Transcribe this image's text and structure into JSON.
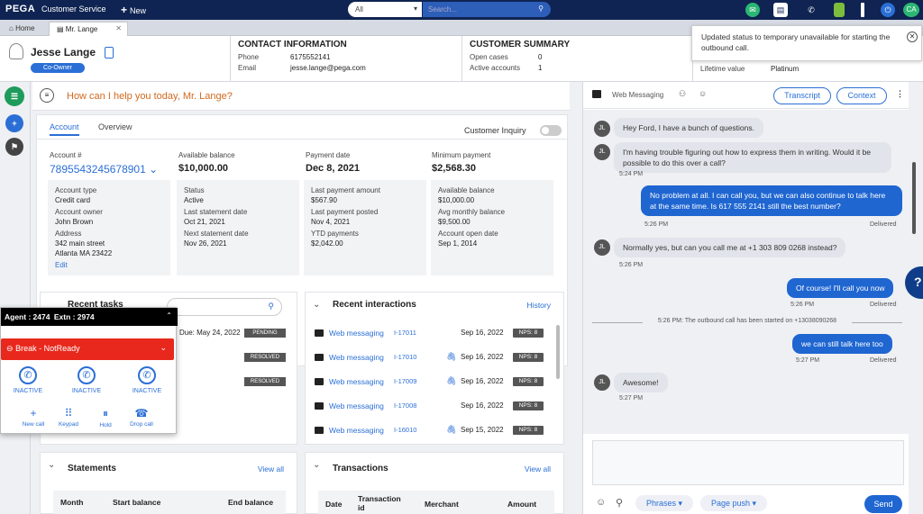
{
  "topbar": {
    "logo": "PEGA",
    "app_name": "Customer Service",
    "new_label": "New",
    "search_scope": "All",
    "search_placeholder": "Search...",
    "user_initials": "CA",
    "icon_colors": {
      "email": "#2bb673",
      "chat": "#ffffff",
      "phone": "#ff3b30",
      "battery": "#7dbd3c",
      "status": "#2b6fd6"
    }
  },
  "tabs": [
    {
      "label": "Home"
    },
    {
      "label": "Mr. Lange"
    }
  ],
  "customer": {
    "name": "Jesse Lange",
    "role": "Co-Owner"
  },
  "contact_info": {
    "title": "CONTACT INFORMATION",
    "phone_label": "Phone",
    "phone": "6175552141",
    "email_label": "Email",
    "email": "jesse.lange@pega.com"
  },
  "customer_summary": {
    "title": "CUSTOMER SUMMARY",
    "open_cases_label": "Open cases",
    "open_cases": "0",
    "active_accounts_label": "Active accounts",
    "active_accounts": "1",
    "lifetime_value_label": "Lifetime value",
    "lifetime_value": "Platinum"
  },
  "toast": {
    "message": "Updated status to temporary unavailable for starting the outbound call."
  },
  "question": "How can I help you today, Mr. Lange?",
  "account": {
    "tabs": [
      "Account",
      "Overview"
    ],
    "customer_inquiry_label": "Customer Inquiry",
    "columns": [
      {
        "label": "Account #",
        "value": "7895543245678901"
      },
      {
        "label": "Available balance",
        "value": "$10,000.00"
      },
      {
        "label": "Payment date",
        "value": "Dec 8, 2021"
      },
      {
        "label": "Minimum payment",
        "value": "$2,568.30"
      }
    ],
    "cards": [
      [
        [
          "Account type",
          "Credit card"
        ],
        [
          "Account owner",
          "John Brown"
        ],
        [
          "Address",
          "342 main street"
        ],
        [
          "",
          "Atlanta  MA 23422"
        ]
      ],
      [
        [
          "Status",
          "Active"
        ],
        [
          "Last statement date",
          "Oct 21, 2021"
        ],
        [
          "Next statement date",
          "Nov 26, 2021"
        ]
      ],
      [
        [
          "Last payment amount",
          "$567.90"
        ],
        [
          "Last payment posted",
          "Nov 4, 2021"
        ],
        [
          "YTD payments",
          "$2,042.00"
        ]
      ],
      [
        [
          "Available balance",
          "$10,000.00"
        ],
        [
          "Avg monthly balance",
          "$9,500.00"
        ],
        [
          "Account open date",
          "Sep 1, 2014"
        ]
      ]
    ],
    "edit_label": "Edit"
  },
  "recent_tasks": {
    "title": "Recent tasks",
    "due": "Due: May 24, 2022",
    "statuses": [
      "PENDING",
      "RESOLVED",
      "RESOLVED"
    ]
  },
  "recent_interactions": {
    "title": "Recent interactions",
    "history_label": "History",
    "rows": [
      {
        "type": "Web messaging",
        "id": "I-17011",
        "date": "Sep 16, 2022",
        "nps": "NPS: 8",
        "attach": false
      },
      {
        "type": "Web messaging",
        "id": "I-17010",
        "date": "Sep 16, 2022",
        "nps": "NPS: 8",
        "attach": true
      },
      {
        "type": "Web messaging",
        "id": "I-17009",
        "date": "Sep 16, 2022",
        "nps": "NPS: 8",
        "attach": true
      },
      {
        "type": "Web messaging",
        "id": "I-17008",
        "date": "Sep 16, 2022",
        "nps": "NPS: 8",
        "attach": false
      },
      {
        "type": "Web messaging",
        "id": "I-16010",
        "date": "Sep 15, 2022",
        "nps": "NPS: 8",
        "attach": true
      }
    ]
  },
  "statements": {
    "title": "Statements",
    "view_all": "View all",
    "headers": [
      "Month",
      "Start balance",
      "End balance"
    ]
  },
  "transactions": {
    "title": "Transactions",
    "view_all": "View all",
    "headers": [
      "Date",
      "Transaction id",
      "Merchant",
      "Amount"
    ]
  },
  "agent": {
    "agent_label": "Agent :",
    "agent_id": "2474",
    "ext_label": "Extn :",
    "ext": "2974",
    "status": "Break - NotReady",
    "lines": [
      "INACTIVE",
      "INACTIVE",
      "INACTIVE"
    ],
    "actions": [
      "New call",
      "Keypad",
      "Hold",
      "Drop call"
    ]
  },
  "chat": {
    "channel": "Web Messaging",
    "transcript_label": "Transcript",
    "context_label": "Context",
    "messages": [
      {
        "from": "JL",
        "text": "Hey Ford, I have a bunch of questions."
      },
      {
        "from": "JL",
        "text": "I'm having trouble figuring out how to express them in writing. Would it be possible to do this over a call?",
        "time": "5:24 PM"
      },
      {
        "from": "agent",
        "text": "No problem at all. I can call you, but we can also continue to talk here at the same time. Is 617 555 2141 still the best number?",
        "time": "5:26 PM",
        "status": "Delivered"
      },
      {
        "from": "JL",
        "text": "Normally yes, but can you call me at +1 303 809 0268 instead?",
        "time": "5:26 PM"
      },
      {
        "from": "agent",
        "text": "Of course! I'll call you now",
        "time": "5:26 PM",
        "status": "Delivered"
      },
      {
        "from": "system",
        "text": "5:26 PM: The outbound call has been started on +13038090268"
      },
      {
        "from": "agent",
        "text": "we can still talk here too",
        "time": "5:27 PM",
        "status": "Delivered"
      },
      {
        "from": "JL",
        "text": "Awesome!",
        "time": "5:27 PM"
      }
    ],
    "phrases_label": "Phrases",
    "page_push_label": "Page push",
    "send_label": "Send"
  },
  "help_label": "?"
}
